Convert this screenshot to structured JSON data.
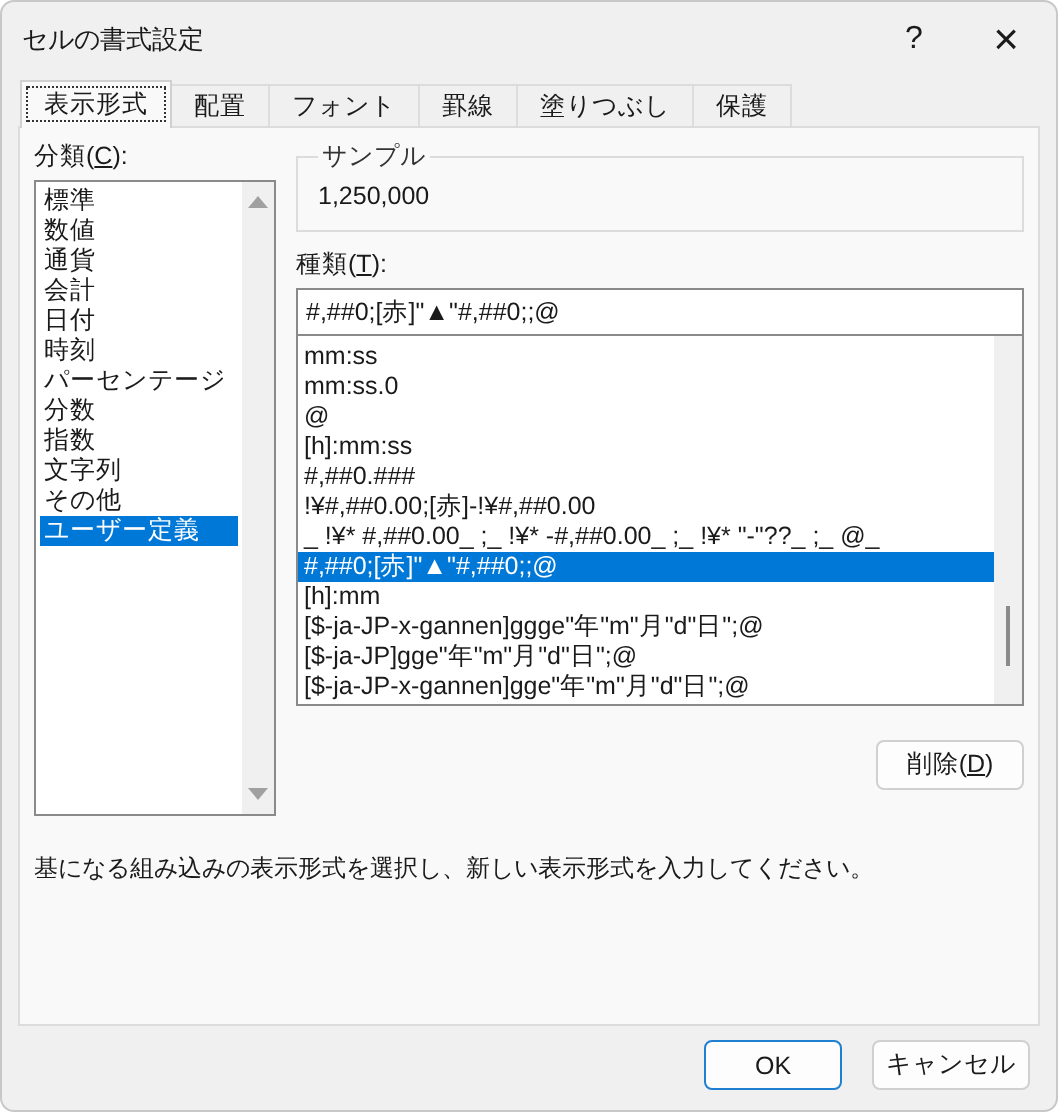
{
  "window": {
    "title": "セルの書式設定",
    "help": "?",
    "close": "×"
  },
  "tabs": [
    {
      "label": "表示形式",
      "selected": true
    },
    {
      "label": "配置",
      "selected": false
    },
    {
      "label": "フォント",
      "selected": false
    },
    {
      "label": "罫線",
      "selected": false
    },
    {
      "label": "塗りつぶし",
      "selected": false
    },
    {
      "label": "保護",
      "selected": false
    }
  ],
  "category": {
    "label": {
      "before": "分類(",
      "key": "C",
      "after": "):"
    },
    "items": [
      {
        "label": "標準",
        "selected": false
      },
      {
        "label": "数値",
        "selected": false
      },
      {
        "label": "通貨",
        "selected": false
      },
      {
        "label": "会計",
        "selected": false
      },
      {
        "label": "日付",
        "selected": false
      },
      {
        "label": "時刻",
        "selected": false
      },
      {
        "label": "パーセンテージ",
        "selected": false
      },
      {
        "label": "分数",
        "selected": false
      },
      {
        "label": "指数",
        "selected": false
      },
      {
        "label": "文字列",
        "selected": false
      },
      {
        "label": "その他",
        "selected": false
      },
      {
        "label": "ユーザー定義",
        "selected": true
      }
    ]
  },
  "sample": {
    "title": "サンプル",
    "value": "1,250,000"
  },
  "type": {
    "label": {
      "before": "種類(",
      "key": "T",
      "after": "):"
    },
    "value": "#,##0;[赤]\"▲\"#,##0;;@",
    "items": [
      {
        "label": "mm:ss",
        "selected": false
      },
      {
        "label": "mm:ss.0",
        "selected": false
      },
      {
        "label": "@",
        "selected": false
      },
      {
        "label": "[h]:mm:ss",
        "selected": false
      },
      {
        "label": "#,##0.###",
        "selected": false
      },
      {
        "label": "!¥#,##0.00;[赤]-!¥#,##0.00",
        "selected": false
      },
      {
        "label": "_ !¥* #,##0.00_ ;_ !¥* -#,##0.00_ ;_ !¥* \"-\"??_ ;_ @_",
        "selected": false
      },
      {
        "label": "#,##0;[赤]\"▲\"#,##0;;@",
        "selected": true
      },
      {
        "label": "[h]:mm",
        "selected": false
      },
      {
        "label": "[$-ja-JP-x-gannen]ggge\"年\"m\"月\"d\"日\";@",
        "selected": false
      },
      {
        "label": "[$-ja-JP]gge\"年\"m\"月\"d\"日\";@",
        "selected": false
      },
      {
        "label": "[$-ja-JP-x-gannen]gge\"年\"m\"月\"d\"日\";@",
        "selected": false
      }
    ]
  },
  "delete_button": {
    "before": "削除(",
    "key": "D",
    "after": ")"
  },
  "description": "基になる組み込みの表示形式を選択し、新しい表示形式を入力してください。",
  "buttons": [
    {
      "label": "OK",
      "kind": "default"
    },
    {
      "label": "キャンセル",
      "kind": "normal"
    }
  ]
}
